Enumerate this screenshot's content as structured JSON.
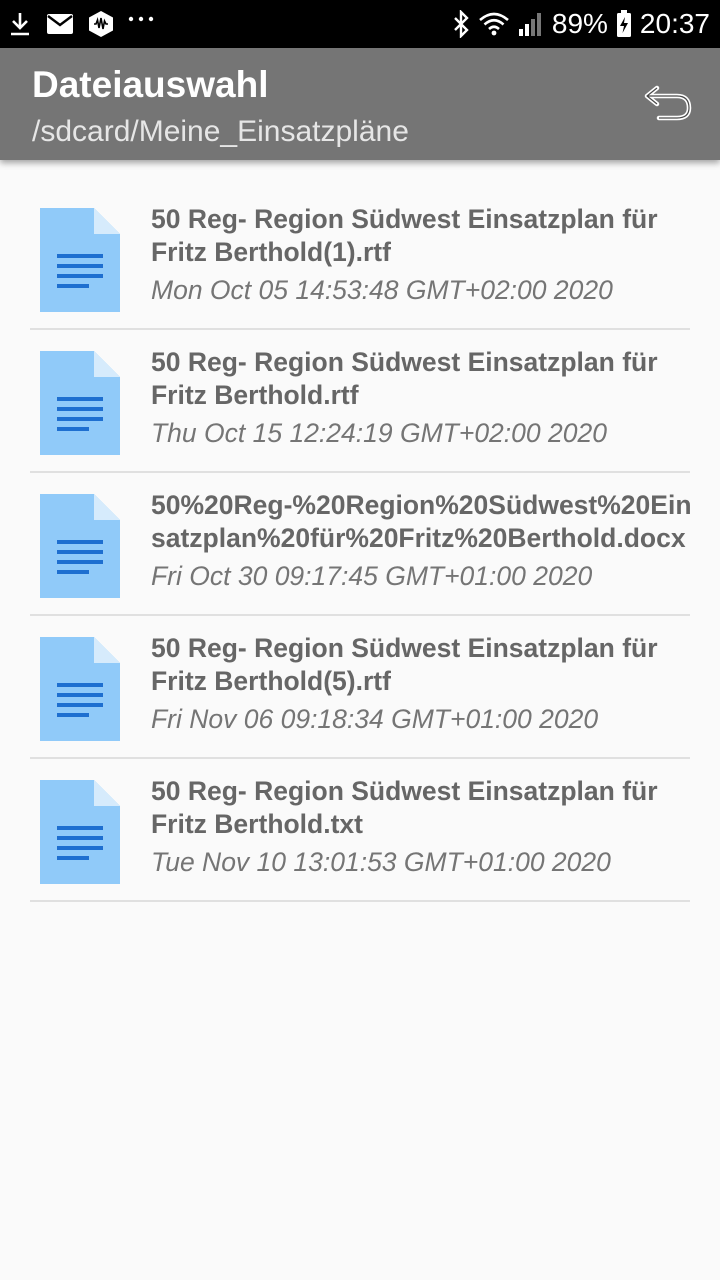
{
  "status_bar": {
    "left_icons": [
      "download-icon",
      "mail-icon",
      "app-notification-icon",
      "more-notifications-icon"
    ],
    "right_icons": [
      "bluetooth-icon",
      "wifi-icon",
      "signal-icon",
      "battery-charging-icon"
    ],
    "battery_percent": "89%",
    "time": "20:37"
  },
  "app_bar": {
    "title": "Dateiauswahl",
    "subtitle": "/sdcard/Meine_Einsatzpläne",
    "back_icon": "back-arrow-icon"
  },
  "colors": {
    "app_bar": "#757575",
    "file_icon_body": "#90caf9",
    "file_icon_lines": "#1e6fd0",
    "divider": "#e0e0e0"
  },
  "files": [
    {
      "name": "50 Reg- Region Südwest Einsatzplan für\nFritz Berthold(1).rtf",
      "date": "Mon Oct 05 14:53:48 GMT+02:00 2020",
      "icon": "document-icon"
    },
    {
      "name": "50 Reg- Region Südwest Einsatzplan für\nFritz Berthold.rtf",
      "date": "Thu Oct 15 12:24:19 GMT+02:00 2020",
      "icon": "document-icon"
    },
    {
      "name": "50%20Reg-%20Region%20Südwest%20Ein\nsatzplan%20für%20Fritz%20Berthold.docx",
      "date": "Fri Oct 30 09:17:45 GMT+01:00 2020",
      "icon": "document-icon"
    },
    {
      "name": "50 Reg- Region Südwest Einsatzplan für\nFritz Berthold(5).rtf",
      "date": "Fri Nov 06 09:18:34 GMT+01:00 2020",
      "icon": "document-icon"
    },
    {
      "name": "50 Reg- Region Südwest Einsatzplan für\nFritz Berthold.txt",
      "date": "Tue Nov 10 13:01:53 GMT+01:00 2020",
      "icon": "document-icon"
    }
  ]
}
